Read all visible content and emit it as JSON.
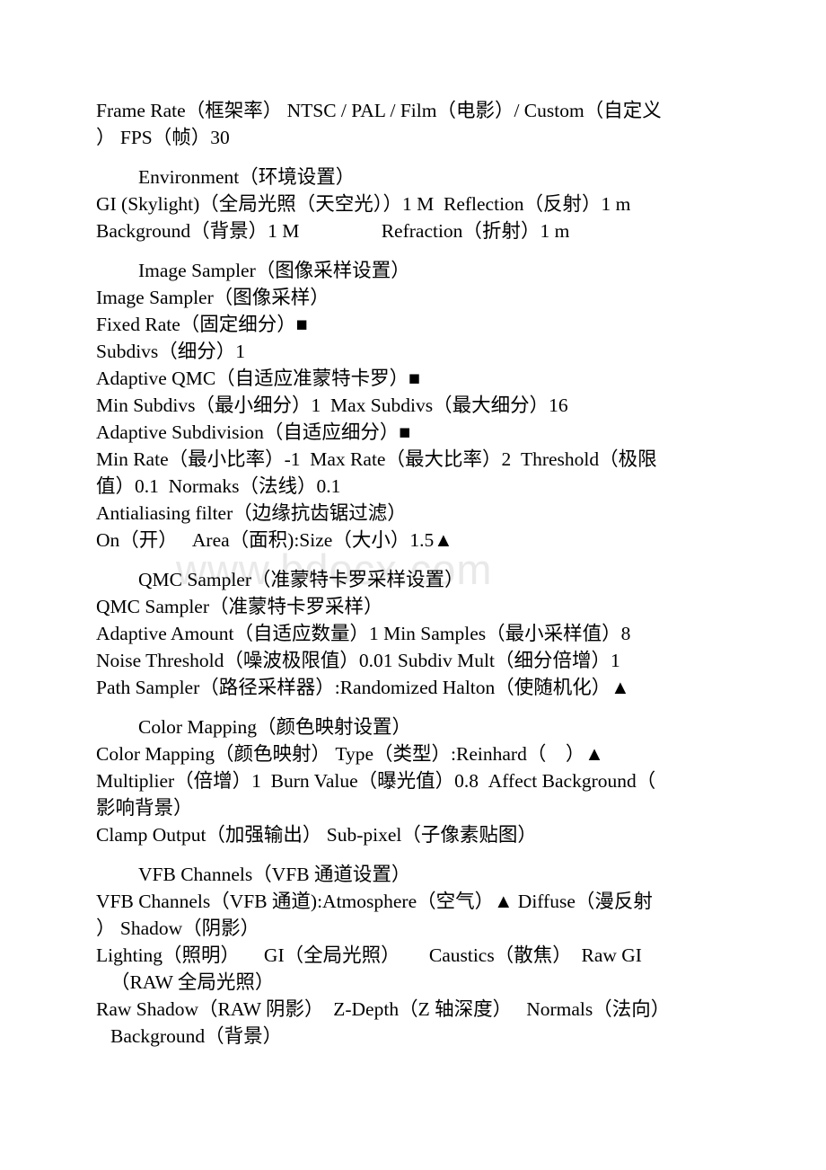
{
  "document": {
    "watermark": "www.bdocx.com",
    "page_background": "#ffffff",
    "text_color": "#000000",
    "watermark_color": "#e9e9e9"
  },
  "content": {
    "frame_rate_line_1": "Frame Rate（框架率） NTSC / PAL / Film（电影）/ Custom（自定义",
    "frame_rate_line_2": "） FPS（帧）30",
    "environment_heading": "Environment（环境设置）",
    "environment_line_1": "GI (Skylight)（全局光照（天空光））1 M  Reflection（反射）1 m",
    "environment_line_2": "Background（背景）1 M                 Refraction（折射）1 m",
    "image_sampler_heading": "Image Sampler（图像采样设置）",
    "image_sampler_line_1": "Image Sampler（图像采样）",
    "image_sampler_line_2": "Fixed Rate（固定细分）■",
    "image_sampler_line_3": "Subdivs（细分）1",
    "image_sampler_line_4": "Adaptive QMC（自适应准蒙特卡罗）■",
    "image_sampler_line_5": "Min Subdivs（最小细分）1  Max Subdivs（最大细分）16",
    "image_sampler_line_6": "Adaptive Subdivision（自适应细分）■",
    "image_sampler_line_7a": "Min Rate（最小比率）-1  Max Rate（最大比率）2  Threshold（极限",
    "image_sampler_line_7b": "值）0.1  Normaks（法线）0.1",
    "image_sampler_line_8": "Antialiasing filter（边缘抗齿锯过滤）",
    "image_sampler_line_9": "On（开）   Area（面积):Size（大小）1.5▲",
    "qmc_sampler_heading": "QMC Sampler（准蒙特卡罗采样设置）",
    "qmc_sampler_line_1": "QMC Sampler（准蒙特卡罗采样）",
    "qmc_sampler_line_2": "Adaptive Amount（自适应数量）1 Min Samples（最小采样值）8",
    "qmc_sampler_line_3": "Noise Threshold（噪波极限值）0.01 Subdiv Mult（细分倍增）1",
    "qmc_sampler_line_4": "Path Sampler（路径采样器）:Randomized Halton（使随机化）▲",
    "color_mapping_heading": "Color Mapping（颜色映射设置）",
    "color_mapping_line_1": "Color Mapping（颜色映射） Type（类型）:Reinhard（    ）▲",
    "color_mapping_line_2a": "Multiplier（倍增）1  Burn Value（曝光值）0.8  Affect Background（",
    "color_mapping_line_2b": "影响背景）",
    "color_mapping_line_3": "Clamp Output（加强输出） Sub-pixel（子像素贴图）",
    "vfb_channels_heading": "VFB Channels（VFB 通道设置）",
    "vfb_channels_line_1a": "VFB Channels（VFB 通道):Atmosphere（空气）▲ Diffuse（漫反射",
    "vfb_channels_line_1b": "） Shadow（阴影）",
    "vfb_channels_line_2a": "Lighting（照明）     GI（全局光照）      Caustics（散焦）  Raw GI",
    "vfb_channels_line_2b": "（RAW 全局光照）",
    "vfb_channels_line_3a": "Raw Shadow（RAW 阴影）  Z-Depth（Z 轴深度）   Normals（法向）",
    "vfb_channels_line_3b": "Background（背景）"
  }
}
